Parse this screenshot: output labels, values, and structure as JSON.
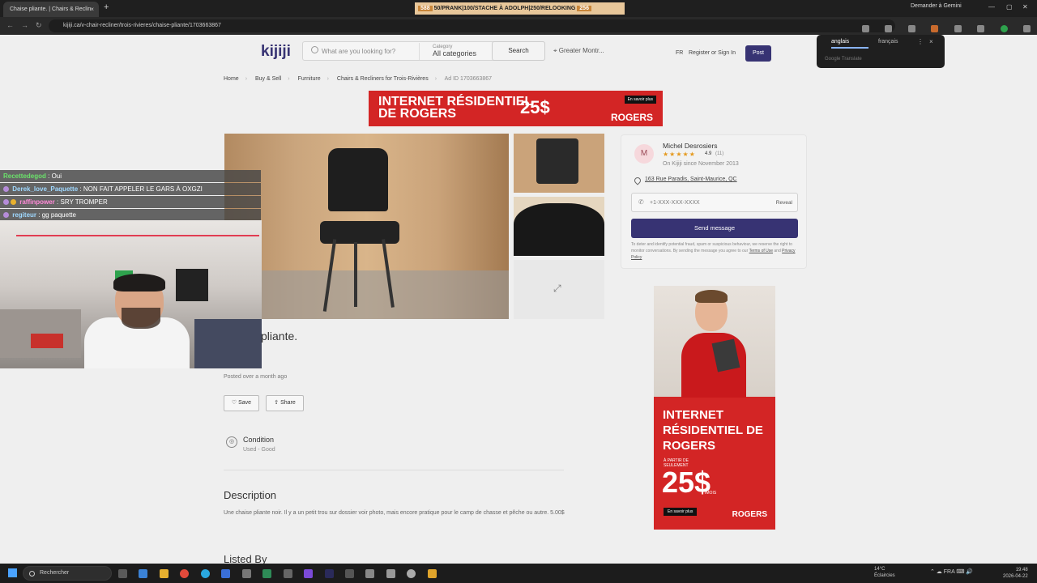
{
  "browser": {
    "tab_title": "Chaise pliante. | Chairs & Reclin",
    "tab_close": "×",
    "new_tab": "+",
    "overlay_banner": {
      "count_left": "588",
      "text": "50/PRANK|100/STACHE À ADOLPH|250/RELOOKING",
      "count_right": "256"
    },
    "gemini_button": "Demander à Gemini",
    "url": "kijiji.ca/v-chair-recliner/trois-rivieres/chaise-pliante/1703663867"
  },
  "header": {
    "logo": "kijiji",
    "search_placeholder": "What are you looking for?",
    "category_label": "Category",
    "category_value": "All categories",
    "search_button": "Search",
    "location": "Greater Montr...",
    "lang": "FR",
    "signin": "Register or Sign In",
    "post": "Post"
  },
  "breadcrumb": {
    "items": [
      "Home",
      "Buy & Sell",
      "Furniture",
      "Chairs & Recliners for Trois-Rivières"
    ],
    "ad_id": "Ad ID 1703663867"
  },
  "top_ad": {
    "title_line1": "INTERNET RÉSIDENTIEL",
    "title_line2": "DE ROGERS",
    "price": "25$",
    "more": "En savoir plus",
    "brand": "ROGERS"
  },
  "listing": {
    "title": "pliante.",
    "posted": "Posted over a month ago",
    "save": "Save",
    "share": "Share",
    "condition_label": "Condition",
    "condition_value": "Used - Good",
    "description_heading": "Description",
    "description": "Une chaise pliante noir. Il y a un petit trou sur dossier voir photo, mais encore pratique pour le camp de chasse et pêche ou autre. 5.00$",
    "listed_by": "Listed By"
  },
  "seller": {
    "initial": "M",
    "name": "Michel Desrosiers",
    "stars": "★★★★★",
    "rating": "4.9",
    "rating_count": "(11)",
    "since": "On Kijiji since November 2013",
    "address": "163 Rue Paradis, Saint-Maurice, QC",
    "phone": "+1-XXX-XXX-XXXX",
    "reveal": "Reveal",
    "send_message": "Send message",
    "legal": "To deter and identify potential fraud, spam or suspicious behaviour, we reserve the right to monitor conversations. By sending the message you agree to our",
    "terms": "Terms of Use",
    "and": "and",
    "privacy": "Privacy Policy"
  },
  "side_ad": {
    "title": "INTERNET RÉSIDENTIEL DE ROGERS",
    "small": "À PARTIR DE SEULEMENT",
    "price": "25$",
    "per": "/MOIS",
    "more": "En savoir plus",
    "brand": "ROGERS"
  },
  "translate": {
    "lang_a": "anglais",
    "lang_b": "français",
    "menu": "⋮",
    "close": "×",
    "provider": "Google Translate"
  },
  "chat": [
    {
      "user": "Recettedegod",
      "msg": ": Oui",
      "color": "#6be36b"
    },
    {
      "user": "Derek_love_Paquette",
      "msg": ": NON FAIT APPELER LE GARS À OXGZI",
      "color": "#9fd8ff"
    },
    {
      "user": "raffinpower",
      "msg": ": SRY TROMPER",
      "color": "#ff8ad8"
    },
    {
      "user": "regiteur",
      "msg": ": gg paquette",
      "color": "#9fd8ff"
    }
  ],
  "taskbar": {
    "search": "Rechercher",
    "weather_temp": "14°C",
    "weather_desc": "Éclaircies",
    "lang": "FRA",
    "time": "19:48",
    "date": "2026-04-22"
  }
}
